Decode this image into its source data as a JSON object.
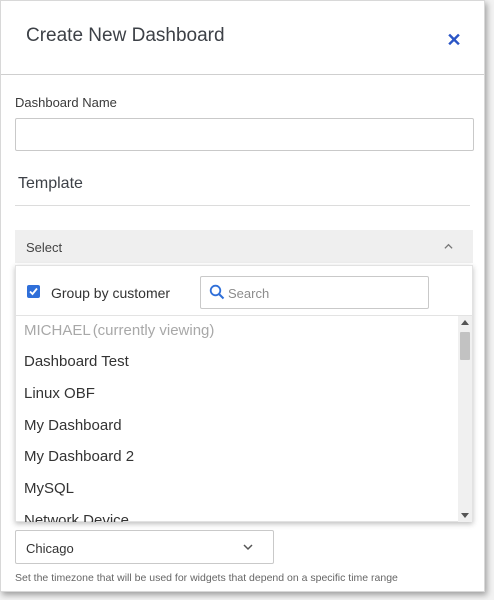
{
  "dialog": {
    "title": "Create New Dashboard",
    "close_icon": "close-icon"
  },
  "form": {
    "dashboard_name_label": "Dashboard Name",
    "dashboard_name_value": "",
    "template_section_title": "Template",
    "template_select_value": "Select"
  },
  "template_dropdown": {
    "group_by_customer_label": "Group by customer",
    "group_by_customer_checked": true,
    "search_placeholder": "Search",
    "group_header": "MICHAEL",
    "group_header_note": "(currently viewing)",
    "items": [
      {
        "label": "Dashboard Test"
      },
      {
        "label": "Linux OBF"
      },
      {
        "label": "My Dashboard"
      },
      {
        "label": "My Dashboard 2"
      },
      {
        "label": "MySQL"
      },
      {
        "label": "Network Device"
      }
    ]
  },
  "timezone": {
    "value": "Chicago",
    "help_text": "Set the timezone that will be used for widgets that depend on a specific time range"
  },
  "colors": {
    "accent": "#2f6fd9",
    "close": "#2a55c6"
  }
}
